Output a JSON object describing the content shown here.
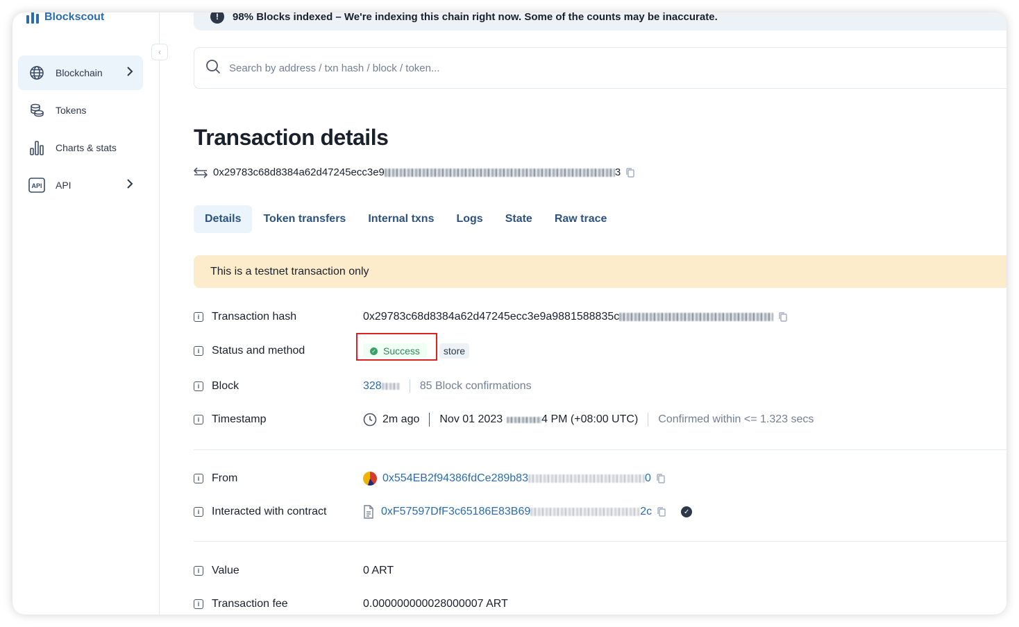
{
  "app": {
    "name": "Blockscout"
  },
  "sidebar": {
    "items": [
      {
        "label": "Blockchain",
        "icon": "globe-icon",
        "has_chevron": true,
        "active": true
      },
      {
        "label": "Tokens",
        "icon": "coins-icon",
        "has_chevron": false
      },
      {
        "label": "Charts & stats",
        "icon": "bar-chart-icon",
        "has_chevron": false
      },
      {
        "label": "API",
        "icon": "api-icon",
        "has_chevron": true
      }
    ]
  },
  "banner": {
    "text": "98% Blocks indexed – We're indexing this chain right now. Some of the counts may be inaccurate."
  },
  "search": {
    "placeholder": "Search by address / txn hash / block / token..."
  },
  "page": {
    "title": "Transaction details",
    "hash_prefix": "0x29783c68d8384a62d47245ecc3e9",
    "hash_suffix": "3"
  },
  "tabs": [
    {
      "label": "Details",
      "active": true
    },
    {
      "label": "Token transfers"
    },
    {
      "label": "Internal txns"
    },
    {
      "label": "Logs"
    },
    {
      "label": "State"
    },
    {
      "label": "Raw trace"
    }
  ],
  "notice": {
    "text": "This is a testnet transaction only"
  },
  "details": {
    "tx_hash": {
      "label": "Transaction hash",
      "value_prefix": "0x29783c68d8384a62d47245ecc3e9a9881588835c",
      "value_suffix": ""
    },
    "status": {
      "label": "Status and method",
      "status": "Success",
      "method": "store"
    },
    "block": {
      "label": "Block",
      "value_prefix": "328",
      "confirmations": "85 Block confirmations"
    },
    "timestamp": {
      "label": "Timestamp",
      "relative": "2m ago",
      "date": "Nov 01 2023",
      "time_suffix": "4 PM (+08:00 UTC)",
      "confirmed": "Confirmed within <= 1.323 secs"
    },
    "from": {
      "label": "From",
      "address_prefix": "0x554EB2f94386fdCe289b83",
      "address_suffix": "0"
    },
    "contract": {
      "label": "Interacted with contract",
      "address_prefix": "0xF57597DfF3c65186E83B69",
      "address_suffix": "2c"
    },
    "value": {
      "label": "Value",
      "value": "0 ART"
    },
    "fee": {
      "label": "Transaction fee",
      "value": "0.000000000028000007 ART"
    }
  },
  "colors": {
    "accent": "#2b6cb0",
    "success": "#38a169",
    "notice_bg": "#fdeccb",
    "highlight_border": "#e02020"
  }
}
